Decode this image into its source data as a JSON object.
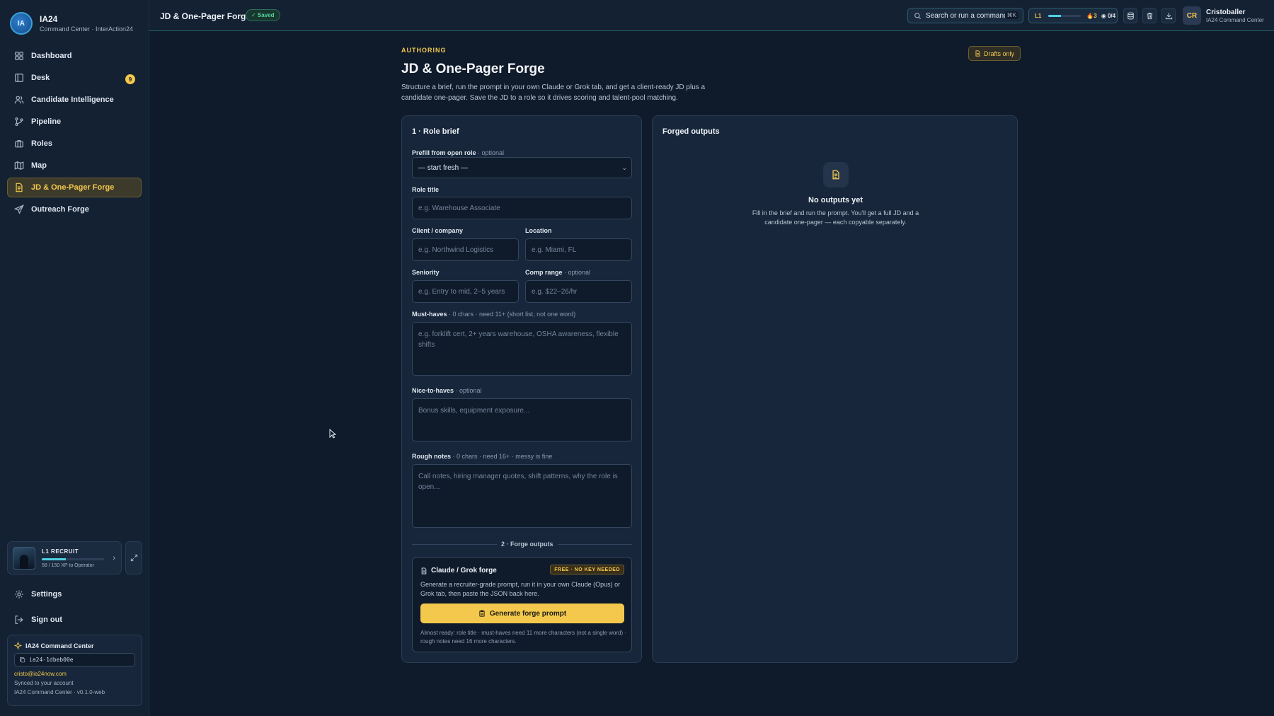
{
  "app": {
    "name": "IA24",
    "subtitle": "Command Center · InterAction24",
    "logo_text": "IA",
    "accent": "#f3c84c",
    "teal": "#4fd1e3"
  },
  "sidebar": {
    "items": [
      {
        "label": "Dashboard",
        "icon": "dashboard-icon"
      },
      {
        "label": "Desk",
        "icon": "desk-icon",
        "badge": "9"
      },
      {
        "label": "Candidate Intelligence",
        "icon": "users-icon"
      },
      {
        "label": "Pipeline",
        "icon": "branch-icon"
      },
      {
        "label": "Roles",
        "icon": "briefcase-icon"
      },
      {
        "label": "Map",
        "icon": "map-icon"
      },
      {
        "label": "JD & One-Pager Forge",
        "icon": "document-icon",
        "active": true
      },
      {
        "label": "Outreach Forge",
        "icon": "send-icon"
      }
    ],
    "xp": {
      "level": "L1 RECRUIT",
      "text": "58 / 150 XP to Operator",
      "progress": 0.39
    },
    "bottom": [
      {
        "label": "Settings",
        "icon": "gear-icon"
      },
      {
        "label": "Sign out",
        "icon": "sign-out-icon"
      }
    ],
    "account": {
      "title": "IA24 Command Center",
      "id": "ia24-1dbeb00e",
      "email": "cristo@ia24now.com",
      "sync": "Synced to your account",
      "version": "IA24 Command Center · v0.1.0-web"
    }
  },
  "topbar": {
    "title": "JD & One-Pager Forge",
    "saved": "✓ Saved",
    "search_placeholder": "Search or run a command",
    "search_kbd": "⌘K",
    "level": "L1",
    "level_progress": 0.39,
    "streak": "🔥3",
    "quests": "◉ 0/4",
    "user": {
      "initials": "CR",
      "name": "Cristoballer",
      "sub": "IA24 Command Center"
    }
  },
  "main": {
    "eyebrow": "AUTHORING",
    "title": "JD & One-Pager Forge",
    "description": "Structure a brief, run the prompt in your own Claude or Grok tab, and get a client-ready JD plus a candidate one-pager. Save the JD to a role so it drives scoring and talent-pool matching.",
    "drafts_badge": "Drafts only"
  },
  "brief": {
    "title": "1 · Role brief",
    "prefill": {
      "label": "Prefill from open role",
      "hint": " · optional",
      "value": "— start fresh —"
    },
    "role_title": {
      "label": "Role title",
      "placeholder": "e.g. Warehouse Associate"
    },
    "client": {
      "label": "Client / company",
      "placeholder": "e.g. Northwind Logistics"
    },
    "location": {
      "label": "Location",
      "placeholder": "e.g. Miami, FL"
    },
    "seniority": {
      "label": "Seniority",
      "placeholder": "e.g. Entry to mid, 2–5 years"
    },
    "comp": {
      "label": "Comp range",
      "hint": " · optional",
      "placeholder": "e.g. $22–26/hr"
    },
    "must_haves": {
      "label": "Must-haves",
      "hint": " · 0 chars · need 11+ (short list, not one word)",
      "placeholder": "e.g. forklift cert, 2+ years warehouse, OSHA awareness, flexible shifts"
    },
    "nice_to_haves": {
      "label": "Nice-to-haves",
      "hint": " · optional",
      "placeholder": "Bonus skills, equipment exposure..."
    },
    "rough_notes": {
      "label": "Rough notes",
      "hint": " · 0 chars · need 16+ · messy is fine",
      "placeholder": "Call notes, hiring manager quotes, shift patterns, why the role is open..."
    },
    "section2": "2 · Forge outputs",
    "forge": {
      "title": "Claude / Grok forge",
      "tag": "FREE · NO KEY NEEDED",
      "description": "Generate a recruiter-grade prompt, run it in your own Claude (Opus) or Grok tab, then paste the JSON back here.",
      "button": "Generate forge prompt",
      "hint": "Almost ready: role title · must-haves need 11 more characters (not a single word) · rough notes need 16 more characters."
    }
  },
  "outputs": {
    "title": "Forged outputs",
    "empty_title": "No outputs yet",
    "empty_desc": "Fill in the brief and run the prompt. You'll get a full JD and a candidate one-pager — each copyable separately."
  }
}
